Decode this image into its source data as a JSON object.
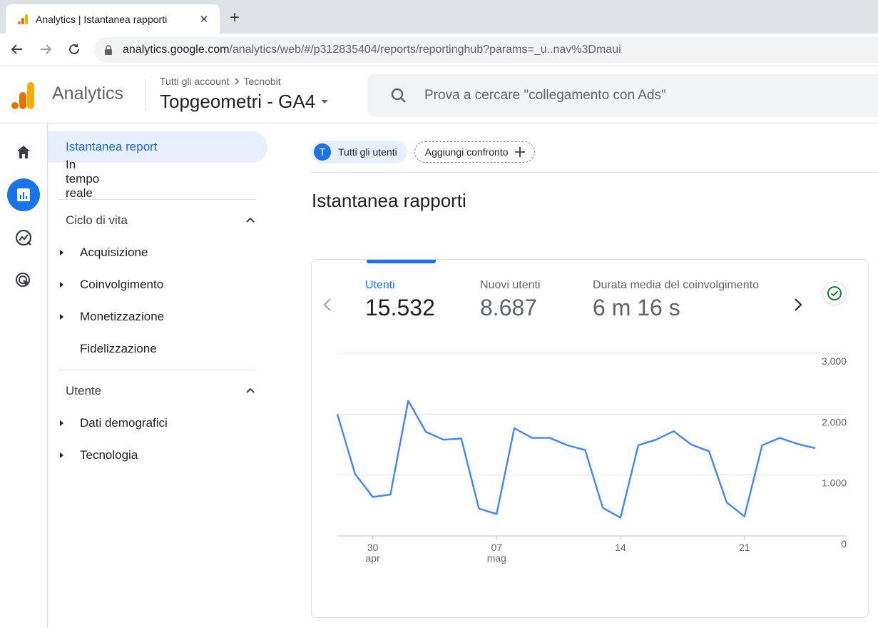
{
  "browser": {
    "tab_title": "Analytics | Istantanea rapporti",
    "url_host": "analytics.google.com",
    "url_path": "/analytics/web/#/p312835404/reports/reportinghub?params=_u..nav%3Dmaui"
  },
  "header": {
    "app_name": "Analytics",
    "breadcrumb_account": "Tutti gli account",
    "breadcrumb_sub": "Tecnobit",
    "property": "Topgeometri - GA4",
    "search_placeholder": "Prova a cercare \"collegamento con Ads\""
  },
  "rail": {
    "items": [
      "home-icon",
      "reports-icon",
      "explore-icon",
      "advertising-icon"
    ],
    "active": "reports-icon"
  },
  "sidenav": {
    "snapshot": "Istantanea report",
    "realtime": "In tempo reale",
    "section_lifecycle": "Ciclo di vita",
    "acquisition": "Acquisizione",
    "engagement": "Coinvolgimento",
    "monetization": "Monetizzazione",
    "retention": "Fidelizzazione",
    "section_user": "Utente",
    "demographics": "Dati demografici",
    "technology": "Tecnologia"
  },
  "filters": {
    "avatar_letter": "T",
    "segment": "Tutti gli utenti",
    "add_comparison": "Aggiungi confronto"
  },
  "main": {
    "title": "Istantanea rapporti"
  },
  "card": {
    "metrics": [
      {
        "label": "Utenti",
        "value": "15.532"
      },
      {
        "label": "Nuovi utenti",
        "value": "8.687"
      },
      {
        "label": "Durata media del coinvolgimento",
        "value": "6 m 16 s"
      }
    ]
  },
  "chart_data": {
    "type": "line",
    "series": [
      {
        "values": [
          2000,
          1020,
          640,
          680,
          2220,
          1710,
          1580,
          1600,
          450,
          360,
          1770,
          1610,
          1610,
          1490,
          1410,
          460,
          300,
          1490,
          1580,
          1720,
          1500,
          1390,
          550,
          320,
          1490,
          1610,
          1510,
          1440
        ]
      }
    ],
    "x_ticks": [
      {
        "index": 2,
        "day": "30",
        "month": "apr"
      },
      {
        "index": 9,
        "day": "07",
        "month": "mag"
      },
      {
        "index": 16,
        "day": "14",
        "month": ""
      },
      {
        "index": 23,
        "day": "21",
        "month": ""
      }
    ],
    "y_ticks": [
      "3.000",
      "2.000",
      "1.000",
      "0"
    ],
    "ylim": [
      0,
      3000
    ],
    "grid": true,
    "color": "#4285f4"
  }
}
